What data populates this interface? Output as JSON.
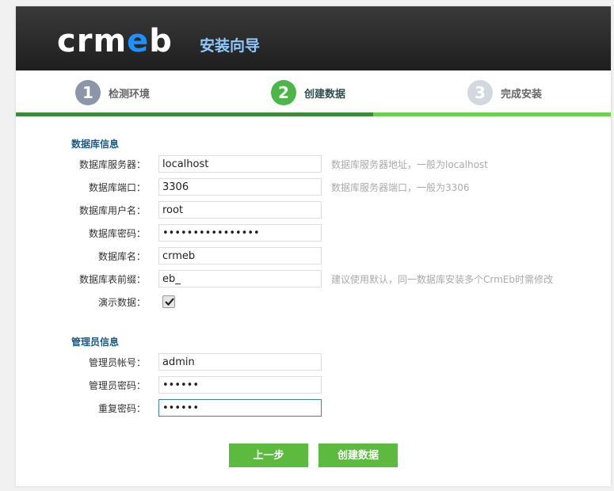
{
  "header": {
    "logo_text_1": "crm",
    "logo_text_2": "e",
    "logo_text_3": "b",
    "title": "安装向导"
  },
  "steps": [
    {
      "num": "1",
      "label": "检测环境"
    },
    {
      "num": "2",
      "label": "创建数据"
    },
    {
      "num": "3",
      "label": "完成安装"
    }
  ],
  "db_section": {
    "title": "数据库信息",
    "host": {
      "label": "数据库服务器：",
      "value": "localhost",
      "hint": "数据库服务器地址，一般为localhost"
    },
    "port": {
      "label": "数据库端口：",
      "value": "3306",
      "hint": "数据库服务器端口，一般为3306"
    },
    "user": {
      "label": "数据库用户名：",
      "value": "root"
    },
    "password": {
      "label": "数据库密码：",
      "value": "••••••••••••••••"
    },
    "name": {
      "label": "数据库名：",
      "value": "crmeb"
    },
    "prefix": {
      "label": "数据库表前缀：",
      "value": "eb_",
      "hint": "建议使用默认，同一数据库安装多个CrmEb时需修改"
    },
    "demo": {
      "label": "演示数据：",
      "checked": true
    }
  },
  "admin_section": {
    "title": "管理员信息",
    "account": {
      "label": "管理员帐号：",
      "value": "admin"
    },
    "password": {
      "label": "管理员密码：",
      "value": "••••••"
    },
    "repeat": {
      "label": "重复密码：",
      "value": "••••••"
    }
  },
  "buttons": {
    "prev": "上一步",
    "create": "创建数据"
  },
  "colors": {
    "accent": "#5cbb3e",
    "header": "#2a2a2a",
    "title": "#8ec8ff",
    "section": "#1f5a85"
  }
}
